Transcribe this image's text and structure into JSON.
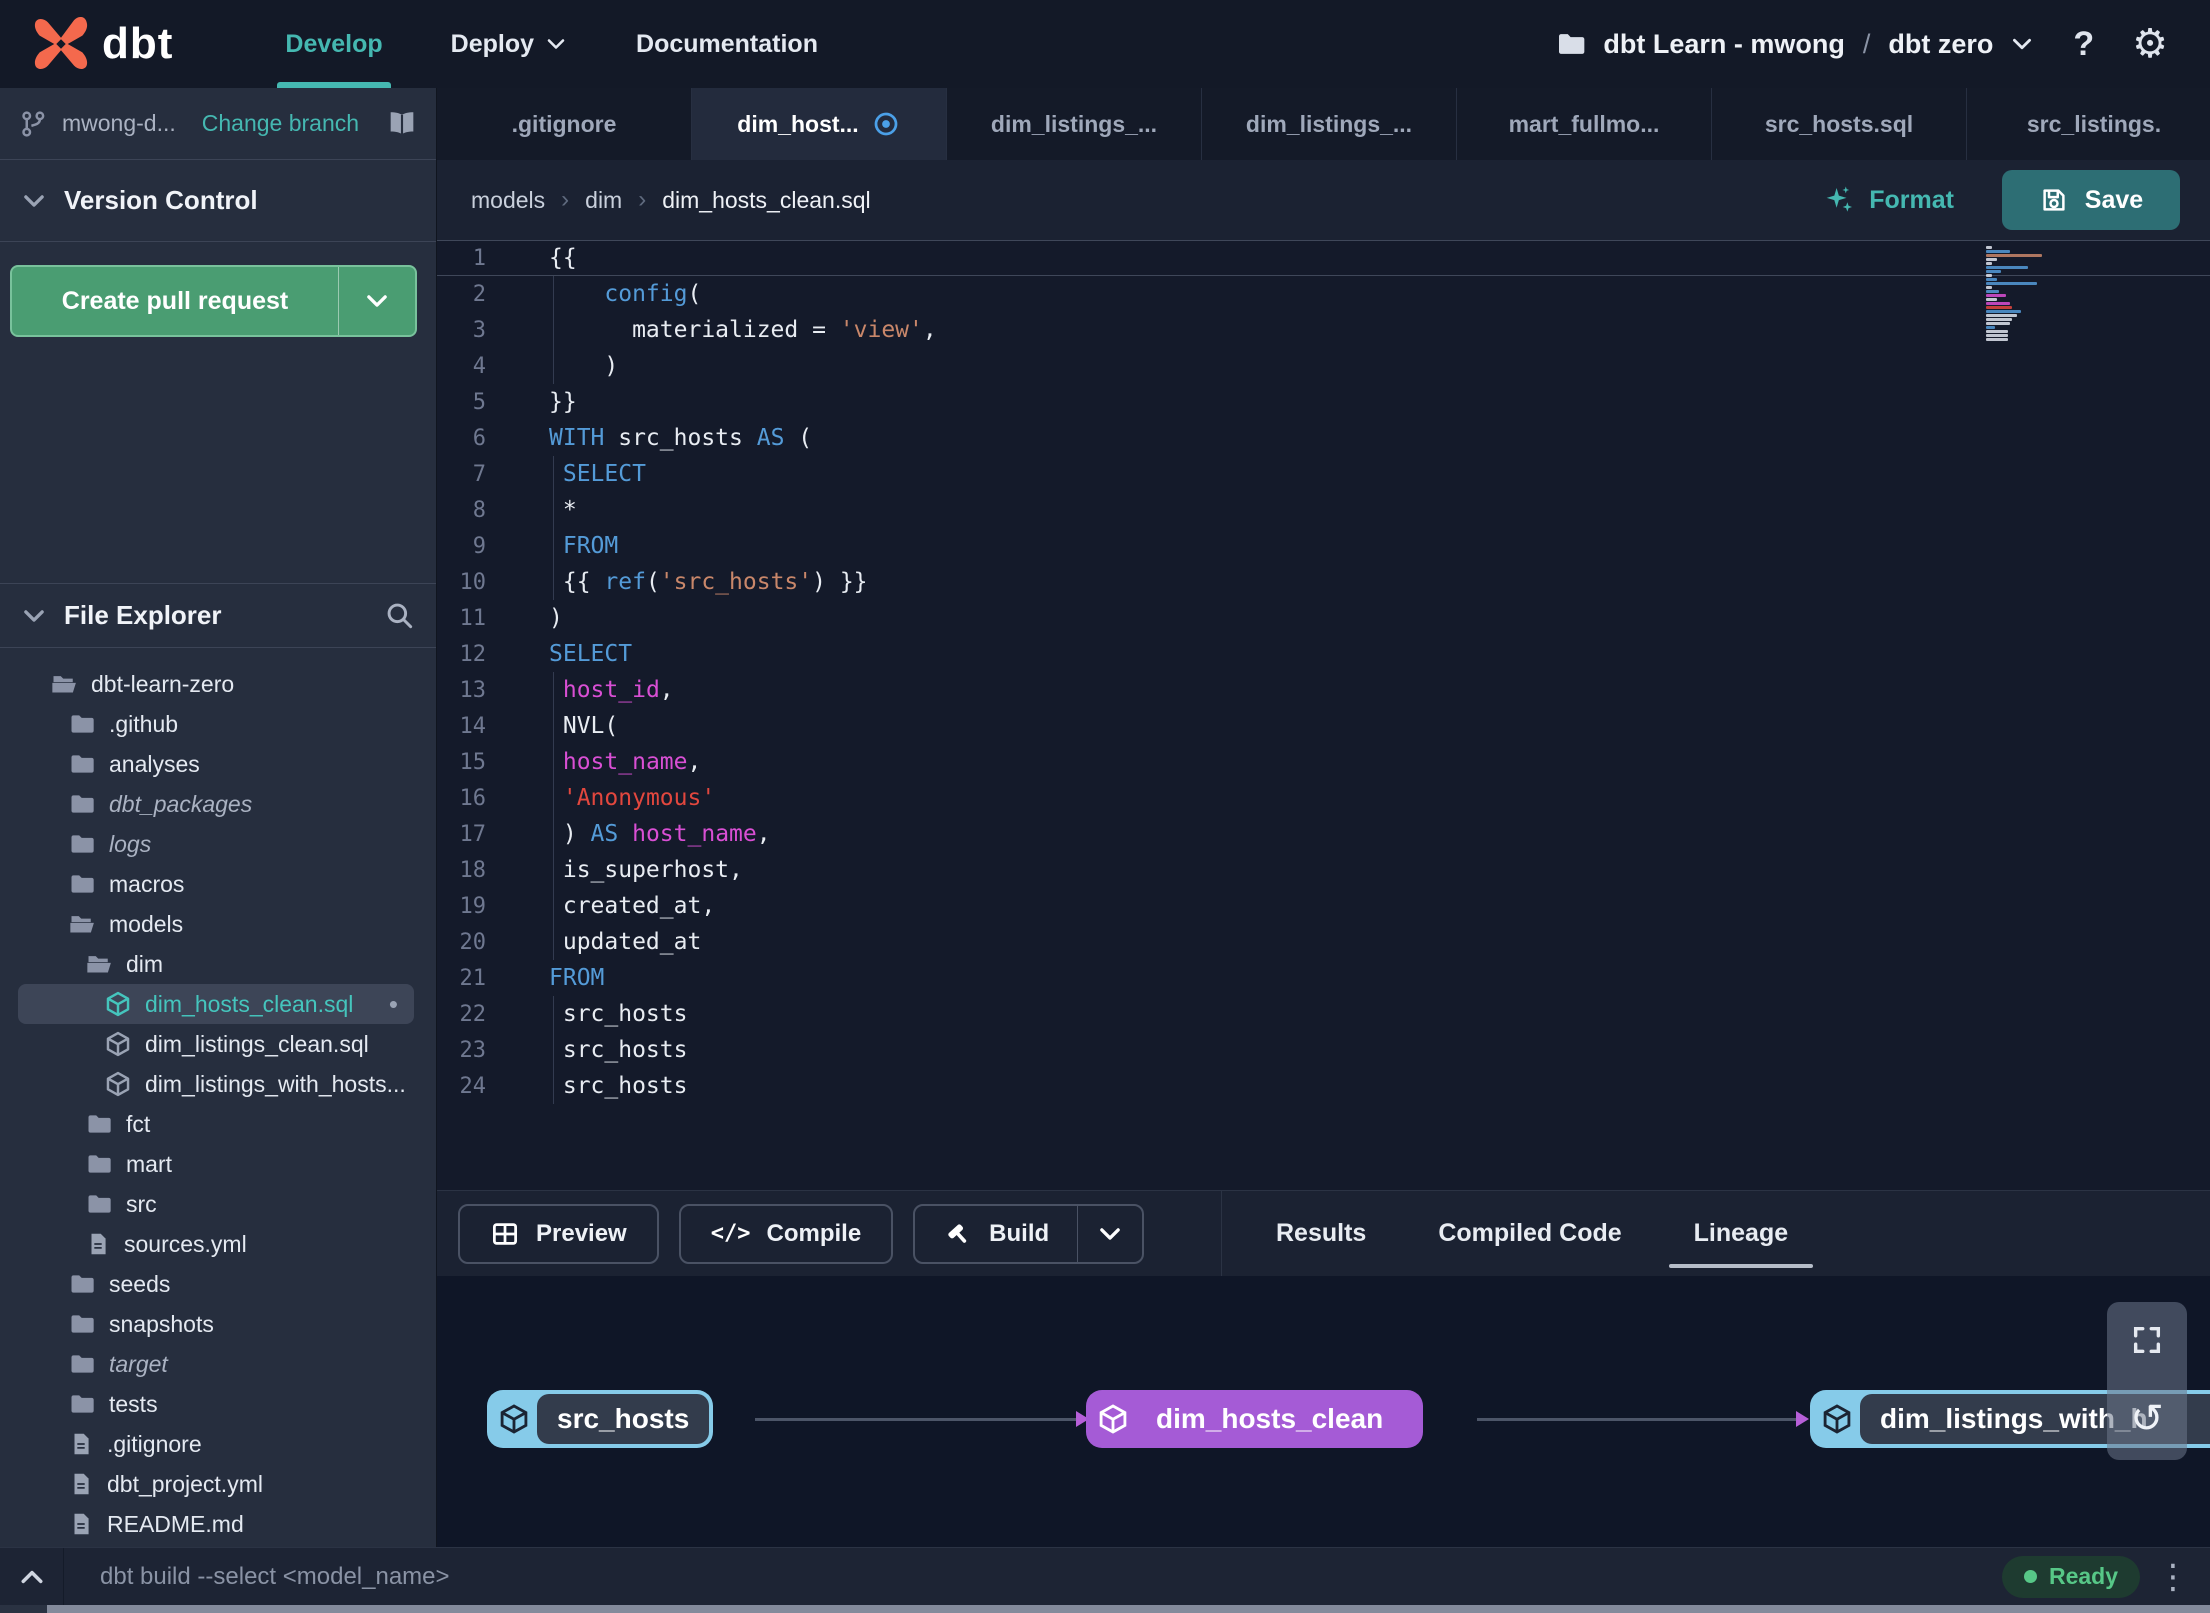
{
  "topbar": {
    "logo_text": "dbt",
    "nav": [
      {
        "label": "Develop",
        "active": true,
        "dropdown": false
      },
      {
        "label": "Deploy",
        "active": false,
        "dropdown": true
      },
      {
        "label": "Documentation",
        "active": false,
        "dropdown": false
      }
    ],
    "project": {
      "name": "dbt Learn - mwong",
      "separator": "/",
      "environment": "dbt zero"
    },
    "help_label": "?"
  },
  "sidebar": {
    "branch": {
      "name": "mwong-d...",
      "change_label": "Change branch"
    },
    "version_control_title": "Version Control",
    "create_pr_label": "Create pull request",
    "file_explorer_title": "File Explorer",
    "tree": [
      {
        "name": "dbt-learn-zero",
        "type": "folder-open",
        "level": 1
      },
      {
        "name": ".github",
        "type": "folder",
        "level": 2
      },
      {
        "name": "analyses",
        "type": "folder",
        "level": 2
      },
      {
        "name": "dbt_packages",
        "type": "folder",
        "level": 2,
        "italic": true
      },
      {
        "name": "logs",
        "type": "folder",
        "level": 2,
        "italic": true
      },
      {
        "name": "macros",
        "type": "folder",
        "level": 2
      },
      {
        "name": "models",
        "type": "folder-open",
        "level": 2
      },
      {
        "name": "dim",
        "type": "folder-open",
        "level": 3
      },
      {
        "name": "dim_hosts_clean.sql",
        "type": "model",
        "level": 4,
        "selected": true,
        "modified": true
      },
      {
        "name": "dim_listings_clean.sql",
        "type": "model",
        "level": 4
      },
      {
        "name": "dim_listings_with_hosts...",
        "type": "model",
        "level": 4
      },
      {
        "name": "fct",
        "type": "folder",
        "level": 3
      },
      {
        "name": "mart",
        "type": "folder",
        "level": 3
      },
      {
        "name": "src",
        "type": "folder",
        "level": 3
      },
      {
        "name": "sources.yml",
        "type": "file",
        "level": 3
      },
      {
        "name": "seeds",
        "type": "folder",
        "level": 2
      },
      {
        "name": "snapshots",
        "type": "folder",
        "level": 2
      },
      {
        "name": "target",
        "type": "folder",
        "level": 2,
        "italic": true
      },
      {
        "name": "tests",
        "type": "folder",
        "level": 2
      },
      {
        "name": ".gitignore",
        "type": "file",
        "level": 2
      },
      {
        "name": "dbt_project.yml",
        "type": "file",
        "level": 2
      },
      {
        "name": "README.md",
        "type": "file",
        "level": 2
      }
    ]
  },
  "tabs": {
    "items": [
      {
        "label": ".gitignore"
      },
      {
        "label": "dim_host...",
        "active": true,
        "modified": true
      },
      {
        "label": "dim_listings_..."
      },
      {
        "label": "dim_listings_..."
      },
      {
        "label": "mart_fullmo..."
      },
      {
        "label": "src_hosts.sql"
      },
      {
        "label": "src_listings."
      }
    ],
    "add_label": "+"
  },
  "editor": {
    "breadcrumb": [
      "models",
      "dim",
      "dim_hosts_clean.sql"
    ],
    "format_label": "Format",
    "save_label": "Save",
    "lines": [
      {
        "n": 1,
        "cur": 1,
        "toks": [
          [
            "{{",
            "pl"
          ]
        ]
      },
      {
        "n": 2,
        "g": 1,
        "toks": [
          [
            "    ",
            "pl"
          ],
          [
            "config",
            "kw"
          ],
          [
            "(",
            "pl"
          ]
        ]
      },
      {
        "n": 3,
        "g": 1,
        "toks": [
          [
            "      materialized = ",
            "pl"
          ],
          [
            "'view'",
            "s1"
          ],
          [
            ",",
            "pl"
          ]
        ]
      },
      {
        "n": 4,
        "g": 1,
        "toks": [
          [
            "    )",
            "pl"
          ]
        ]
      },
      {
        "n": 5,
        "toks": [
          [
            "}}",
            "pl"
          ]
        ]
      },
      {
        "n": 6,
        "toks": [
          [
            "WITH",
            "kw"
          ],
          [
            " src_hosts ",
            "pl"
          ],
          [
            "AS",
            "kw"
          ],
          [
            " (",
            "pl"
          ]
        ]
      },
      {
        "n": 7,
        "g": 1,
        "toks": [
          [
            " ",
            "pl"
          ],
          [
            "SELECT",
            "kw"
          ]
        ]
      },
      {
        "n": 8,
        "g": 1,
        "toks": [
          [
            " *",
            "pl"
          ]
        ]
      },
      {
        "n": 9,
        "g": 1,
        "toks": [
          [
            " ",
            "pl"
          ],
          [
            "FROM",
            "kw"
          ]
        ]
      },
      {
        "n": 10,
        "g": 1,
        "toks": [
          [
            " {{ ",
            "pl"
          ],
          [
            "ref",
            "kw"
          ],
          [
            "(",
            "pl"
          ],
          [
            "'src_hosts'",
            "s1"
          ],
          [
            ") }}",
            "pl"
          ]
        ]
      },
      {
        "n": 11,
        "toks": [
          [
            ")",
            "pl"
          ]
        ]
      },
      {
        "n": 12,
        "toks": [
          [
            "SELECT",
            "kw"
          ]
        ]
      },
      {
        "n": 13,
        "g": 1,
        "toks": [
          [
            " ",
            "pl"
          ],
          [
            "host_id",
            "id"
          ],
          [
            ",",
            "pl"
          ]
        ]
      },
      {
        "n": 14,
        "g": 1,
        "toks": [
          [
            " NVL(",
            "pl"
          ]
        ]
      },
      {
        "n": 15,
        "g": 1,
        "toks": [
          [
            " ",
            "pl"
          ],
          [
            "host_name",
            "id"
          ],
          [
            ",",
            "pl"
          ]
        ]
      },
      {
        "n": 16,
        "g": 1,
        "toks": [
          [
            " ",
            "pl"
          ],
          [
            "'Anonymous'",
            "s2"
          ]
        ]
      },
      {
        "n": 17,
        "g": 1,
        "toks": [
          [
            " ) ",
            "pl"
          ],
          [
            "AS",
            "kw"
          ],
          [
            " ",
            "pl"
          ],
          [
            "host_name",
            "id"
          ],
          [
            ",",
            "pl"
          ]
        ]
      },
      {
        "n": 18,
        "g": 1,
        "toks": [
          [
            " is_superhost,",
            "pl"
          ]
        ]
      },
      {
        "n": 19,
        "g": 1,
        "toks": [
          [
            " created_at,",
            "pl"
          ]
        ]
      },
      {
        "n": 20,
        "g": 1,
        "toks": [
          [
            " updated_at",
            "pl"
          ]
        ]
      },
      {
        "n": 21,
        "toks": [
          [
            "FROM",
            "kw"
          ]
        ]
      },
      {
        "n": 22,
        "g": 1,
        "toks": [
          [
            " src_hosts",
            "pl"
          ]
        ]
      },
      {
        "n": 23,
        "g": 1,
        "toks": [
          [
            " src_hosts",
            "pl"
          ]
        ]
      },
      {
        "n": 24,
        "g": 1,
        "toks": [
          [
            " src_hosts",
            "pl"
          ]
        ]
      }
    ]
  },
  "panel": {
    "actions": {
      "preview": "Preview",
      "compile": "Compile",
      "build": "Build"
    },
    "tabs": [
      {
        "label": "Results",
        "active": false
      },
      {
        "label": "Compiled Code",
        "active": false
      },
      {
        "label": "Lineage",
        "active": true
      }
    ]
  },
  "lineage": {
    "nodes": [
      {
        "label": "src_hosts",
        "kind": "source"
      },
      {
        "label": "dim_hosts_clean",
        "kind": "model"
      },
      {
        "label": "dim_listings_with_h",
        "kind": "source"
      }
    ]
  },
  "statusbar": {
    "placeholder": "dbt build --select <model_name>",
    "status": "Ready"
  },
  "colors": {
    "accent_teal": "#45b8b1",
    "brand_orange": "#f4694d",
    "pr_green": "#4a9d72",
    "save_teal": "#2d6e74",
    "node_blue": "#86cbe9",
    "node_purple": "#a55bd6",
    "ready_green": "#57c787",
    "modified_blue": "#4ba0e8",
    "syntax": {
      "pl": "#e8ecf2",
      "kw": "#549bd8",
      "id": "#d94fd4",
      "s1": "#c9876a",
      "s2": "#e2473e"
    }
  }
}
